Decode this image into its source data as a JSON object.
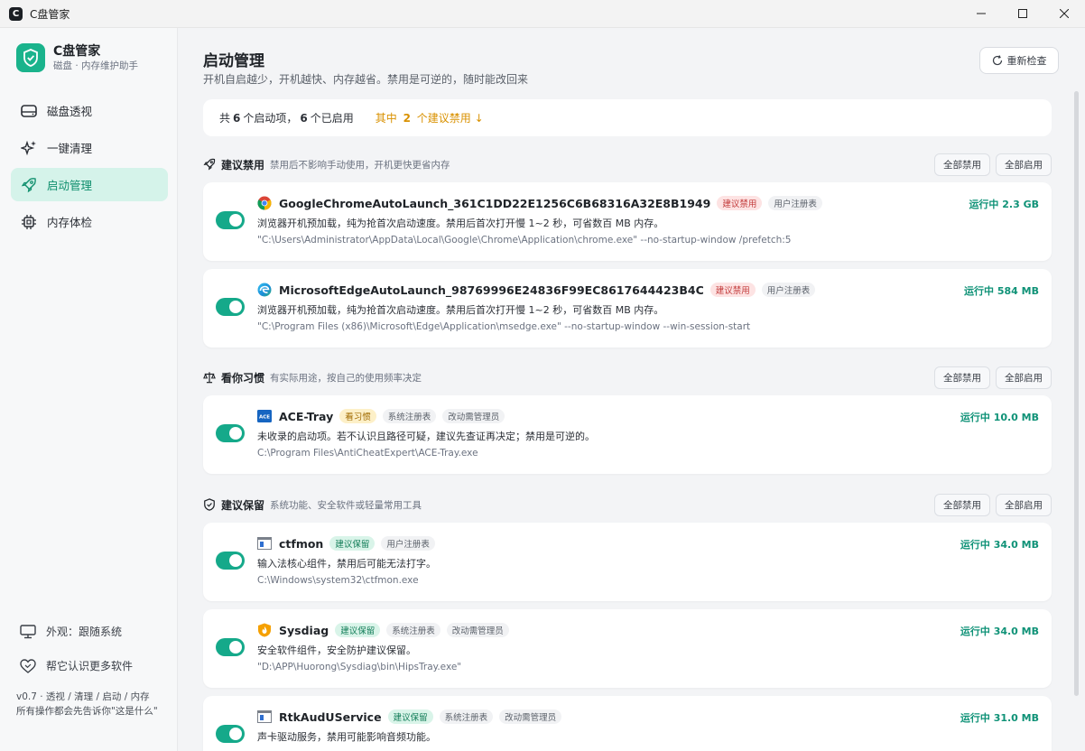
{
  "window": {
    "title": "C盘管家"
  },
  "sidebar": {
    "brand_name": "C盘管家",
    "brand_sub": "磁盘 · 内存维护助手",
    "items": [
      {
        "label": "磁盘透视"
      },
      {
        "label": "一键清理"
      },
      {
        "label": "启动管理"
      },
      {
        "label": "内存体检"
      }
    ],
    "appearance_label": "外观：跟随系统",
    "help_label": "帮它认识更多软件",
    "version_line1": "v0.7 · 透视 / 清理 / 启动 / 内存",
    "version_line2": "所有操作都会先告诉你\"这是什么\""
  },
  "header": {
    "title": "启动管理",
    "subtitle": "开机自启越少，开机越快、内存越省。禁用是可逆的，随时能改回来",
    "recheck_label": "重新检查"
  },
  "summary": {
    "prefix": "共",
    "total": "6",
    "mid": "个启动项，",
    "enabled": "6",
    "suffix": "个已启用",
    "hint_prefix": "其中",
    "hint_count": "2",
    "hint_suffix": "个建议禁用 ↓"
  },
  "actions": {
    "disable_all": "全部禁用",
    "enable_all": "全部启用"
  },
  "sections": [
    {
      "title": "建议禁用",
      "desc": "禁用后不影响手动使用，开机更快更省内存",
      "items": [
        {
          "name": "GoogleChromeAutoLaunch_361C1DD22E1256C6B68316A32E8B1949",
          "tags": [
            "建议禁用",
            "用户注册表"
          ],
          "desc": "浏览器开机预加载，纯为抢首次启动速度。禁用后首次打开慢 1~2 秒，可省数百 MB 内存。",
          "path": "\"C:\\Users\\Administrator\\AppData\\Local\\Google\\Chrome\\Application\\chrome.exe\" --no-startup-window /prefetch:5",
          "status": "运行中 2.3 GB"
        },
        {
          "name": "MicrosoftEdgeAutoLaunch_98769996E24836F99EC8617644423B4C",
          "tags": [
            "建议禁用",
            "用户注册表"
          ],
          "desc": "浏览器开机预加载，纯为抢首次启动速度。禁用后首次打开慢 1~2 秒，可省数百 MB 内存。",
          "path": "\"C:\\Program Files (x86)\\Microsoft\\Edge\\Application\\msedge.exe\" --no-startup-window --win-session-start",
          "status": "运行中 584 MB"
        }
      ]
    },
    {
      "title": "看你习惯",
      "desc": "有实际用途，按自己的使用频率决定",
      "items": [
        {
          "name": "ACE-Tray",
          "tags": [
            "看习惯",
            "系统注册表",
            "改动需管理员"
          ],
          "desc": "未收录的启动项。若不认识且路径可疑，建议先查证再决定；禁用是可逆的。",
          "path": "C:\\Program Files\\AntiCheatExpert\\ACE-Tray.exe",
          "status": "运行中 10.0 MB"
        }
      ]
    },
    {
      "title": "建议保留",
      "desc": "系统功能、安全软件或轻量常用工具",
      "items": [
        {
          "name": "ctfmon",
          "tags": [
            "建议保留",
            "用户注册表"
          ],
          "desc": "输入法核心组件，禁用后可能无法打字。",
          "path": "C:\\Windows\\system32\\ctfmon.exe",
          "status": "运行中 34.0 MB"
        },
        {
          "name": "Sysdiag",
          "tags": [
            "建议保留",
            "系统注册表",
            "改动需管理员"
          ],
          "desc": "安全软件组件，安全防护建议保留。",
          "path": "\"D:\\APP\\Huorong\\Sysdiag\\bin\\HipsTray.exe\"",
          "status": "运行中 34.0 MB"
        },
        {
          "name": "RtkAudUService",
          "tags": [
            "建议保留",
            "系统注册表",
            "改动需管理员"
          ],
          "desc": "声卡驱动服务，禁用可能影响音频功能。",
          "path": "",
          "status": "运行中 31.0 MB"
        }
      ]
    }
  ],
  "icons": {
    "chrome": "chrome-logo-icon",
    "edge": "edge-logo-icon",
    "ace": "ace-app-icon",
    "ctfmon": "window-app-icon",
    "sysdiag": "huorong-shield-icon",
    "rtk": "window-app-icon"
  },
  "colors": {
    "accent": "#15a98a",
    "nav_active_bg": "#d5f3ea",
    "warn": "#d99100"
  }
}
